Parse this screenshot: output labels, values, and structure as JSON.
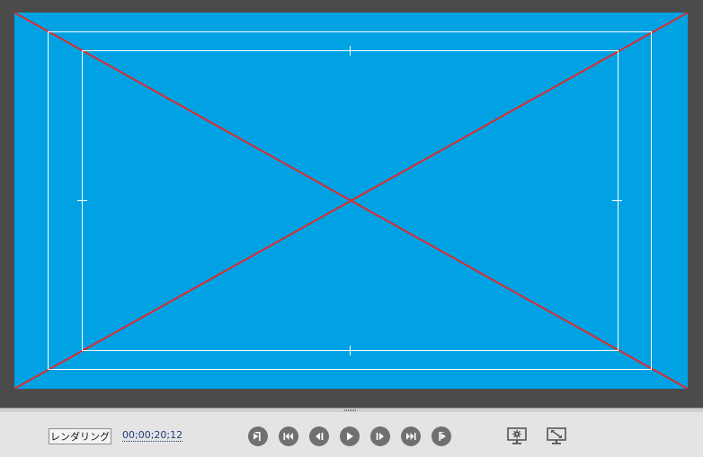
{
  "toolbar": {
    "render_label": "レンダリング",
    "timecode": "00;00;20;12"
  },
  "colors": {
    "canvas": "#00a2e4",
    "guide_lines": "#e02a2a",
    "safe_frame": "#ffffff",
    "viewer_bg": "#4b4b4b",
    "toolbar_bg": "#e4e4e4",
    "button": "#707070"
  },
  "icons": {
    "transport": [
      "go-to-in-icon",
      "go-to-start-icon",
      "step-back-icon",
      "play-icon",
      "step-forward-icon",
      "go-to-end-icon",
      "go-to-out-icon"
    ],
    "display": [
      "monitor-settings-icon",
      "fullscreen-monitor-icon"
    ]
  }
}
